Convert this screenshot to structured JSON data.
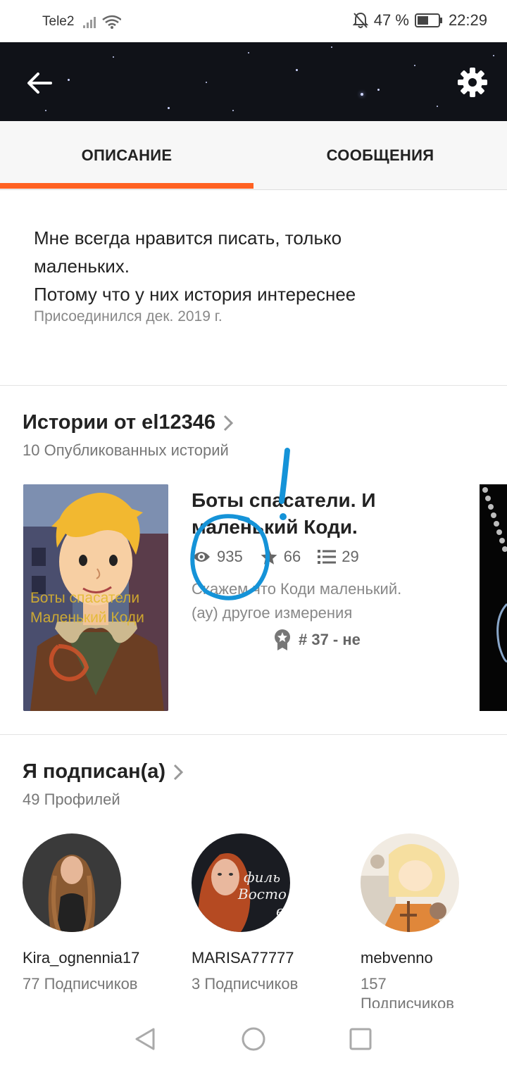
{
  "status_bar": {
    "carrier": "Tele2",
    "battery": "47 %",
    "time": "22:29"
  },
  "header": {
    "back_icon": "arrow-left-icon",
    "settings_icon": "gear-icon"
  },
  "tabs": [
    {
      "label": "ОПИСАНИЕ",
      "active": true
    },
    {
      "label": "СООБЩЕНИЯ",
      "active": false
    }
  ],
  "accent_color": "#ff6122",
  "about": {
    "line1": "Мне всегда нравится писать, только",
    "line2": "маленьких.",
    "line3": "Потому что у них история интереснее",
    "joined": "Присоединился дек. 2019 г."
  },
  "stories": {
    "title": "Истории от el12346",
    "count": "10 Опубликованных историй",
    "items": [
      {
        "cover_text_1": "Боты спасатели",
        "cover_text_2": "Маленький Коди",
        "title_1": "Боты спасатели. И",
        "title_2": "маленький Коди.",
        "views": "935",
        "votes": "66",
        "parts": "29",
        "desc_1": "Скажем что Коди маленький.",
        "desc_2": "(ау) другое измерения",
        "rank": "# 37 - не"
      }
    ]
  },
  "following": {
    "title": "Я подписан(а)",
    "count": "49 Профилей",
    "profiles": [
      {
        "name": "Kira_ognennia17",
        "followers": "77 Подписчиков"
      },
      {
        "name": "MARISA77777",
        "followers": "3 Подписчиков",
        "avatar_text_1": "филь",
        "avatar_text_2": "Восто",
        "avatar_text_3": "в"
      },
      {
        "name": "mebvenno",
        "followers_1": "157",
        "followers_2": "Подписчиков"
      }
    ]
  }
}
